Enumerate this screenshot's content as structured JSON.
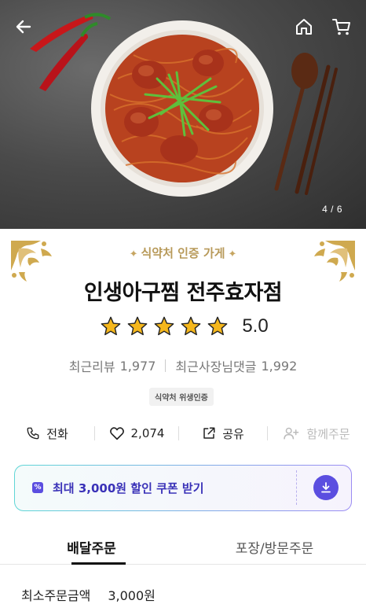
{
  "hero": {
    "page_current": "4",
    "page_total": "6",
    "page_indicator": "4 / 6",
    "icons": [
      "back-arrow-icon",
      "home-icon",
      "cart-icon"
    ]
  },
  "store": {
    "certification_label": "식약처 인증 가게",
    "name": "인생아구찜 전주효자점",
    "rating": "5.0",
    "rating_stars": 5,
    "recent_reviews_label": "최근리뷰",
    "recent_reviews_count": "1,977",
    "owner_replies_label": "최근사장님댓글",
    "owner_replies_count": "1,992",
    "badge": "식약처 위생인증"
  },
  "actions": {
    "call_label": "전화",
    "like_count": "2,074",
    "share_label": "공유",
    "group_order_label": "함께주문"
  },
  "coupon": {
    "icon_glyph": "%",
    "text": "최대 3,000원 할인 쿠폰 받기"
  },
  "tabs": [
    {
      "label": "배달주문",
      "active": true
    },
    {
      "label": "포장/방문주문",
      "active": false
    }
  ],
  "min_order": {
    "label": "최소주문금액",
    "value": "3,000원"
  },
  "colors": {
    "star": "#f5b71c",
    "gold": "#b89a5a",
    "coupon_text": "#3a32b8",
    "coupon_accent": "#5b4ee0"
  }
}
